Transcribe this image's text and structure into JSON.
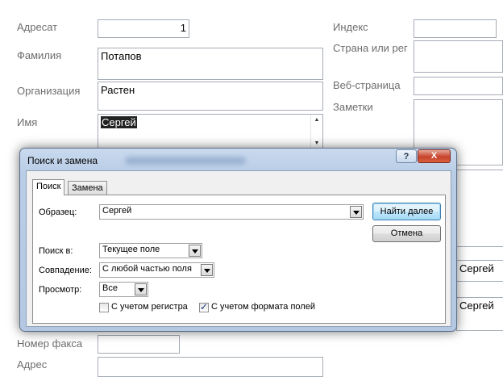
{
  "form": {
    "addressee_label": "Адресат",
    "addressee_value": "1",
    "surname_label": "Фамилия",
    "surname_value": "Потапов",
    "org_label": "Организация",
    "org_value": "Растен",
    "name_label": "Имя",
    "name_value": "Сергей",
    "index_label": "Индекс",
    "country_label": "Страна или рег",
    "web_label": "Веб-страница",
    "notes_label": "Заметки",
    "fax_label": "Номер факса",
    "address_label": "Адрес",
    "right_value_1": "Сергей",
    "right_value_2": "Сергей"
  },
  "dialog": {
    "title": "Поиск и замена",
    "help_glyph": "?",
    "close_glyph": "X",
    "tabs": [
      "Поиск",
      "Замена"
    ],
    "find_label": "Образец:",
    "find_value": "Сергей",
    "find_next": "Найти далее",
    "cancel": "Отмена",
    "look_in_label": "Поиск в:",
    "look_in_value": "Текущее поле",
    "match_label": "Совпадение:",
    "match_value": "С любой частью поля",
    "search_label": "Просмотр:",
    "search_value": "Все",
    "match_case_label": "С учетом регистра",
    "match_case_checked": false,
    "format_label": "С учетом формата полей",
    "format_checked": true
  }
}
